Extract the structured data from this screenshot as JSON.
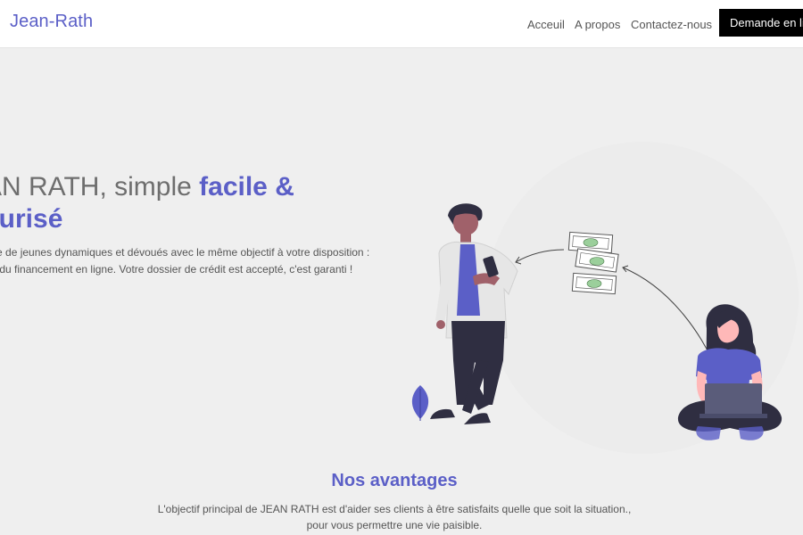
{
  "nav": {
    "brand": "Jean-Rath",
    "links": [
      "Acceuil",
      "A propos",
      "Contactez-nous"
    ],
    "cta": "Demande en ligne"
  },
  "hero": {
    "title_plain": "AN RATH, simple ",
    "title_accent": "facile &",
    "title_line2": "curisé",
    "desc_line1": "uipe de jeunes dynamiques et dévoués avec le même objectif à votre disposition :",
    "desc_line2": "ste du financement en ligne. Votre dossier de crédit est accepté, c'est garanti !"
  },
  "avantages": {
    "title": "Nos avantages",
    "line1": "L'objectif principal de JEAN RATH est d'aider ses clients à être satisfaits quelle que soit la situation.,",
    "line2": "pour vous permettre une vie paisible."
  },
  "colors": {
    "accent": "#5b5fc7",
    "cta_bg": "#000000",
    "page_bg": "#efefef"
  },
  "icons": [
    "money-bill-icon",
    "leaf-icon",
    "laptop-icon",
    "phone-icon"
  ]
}
